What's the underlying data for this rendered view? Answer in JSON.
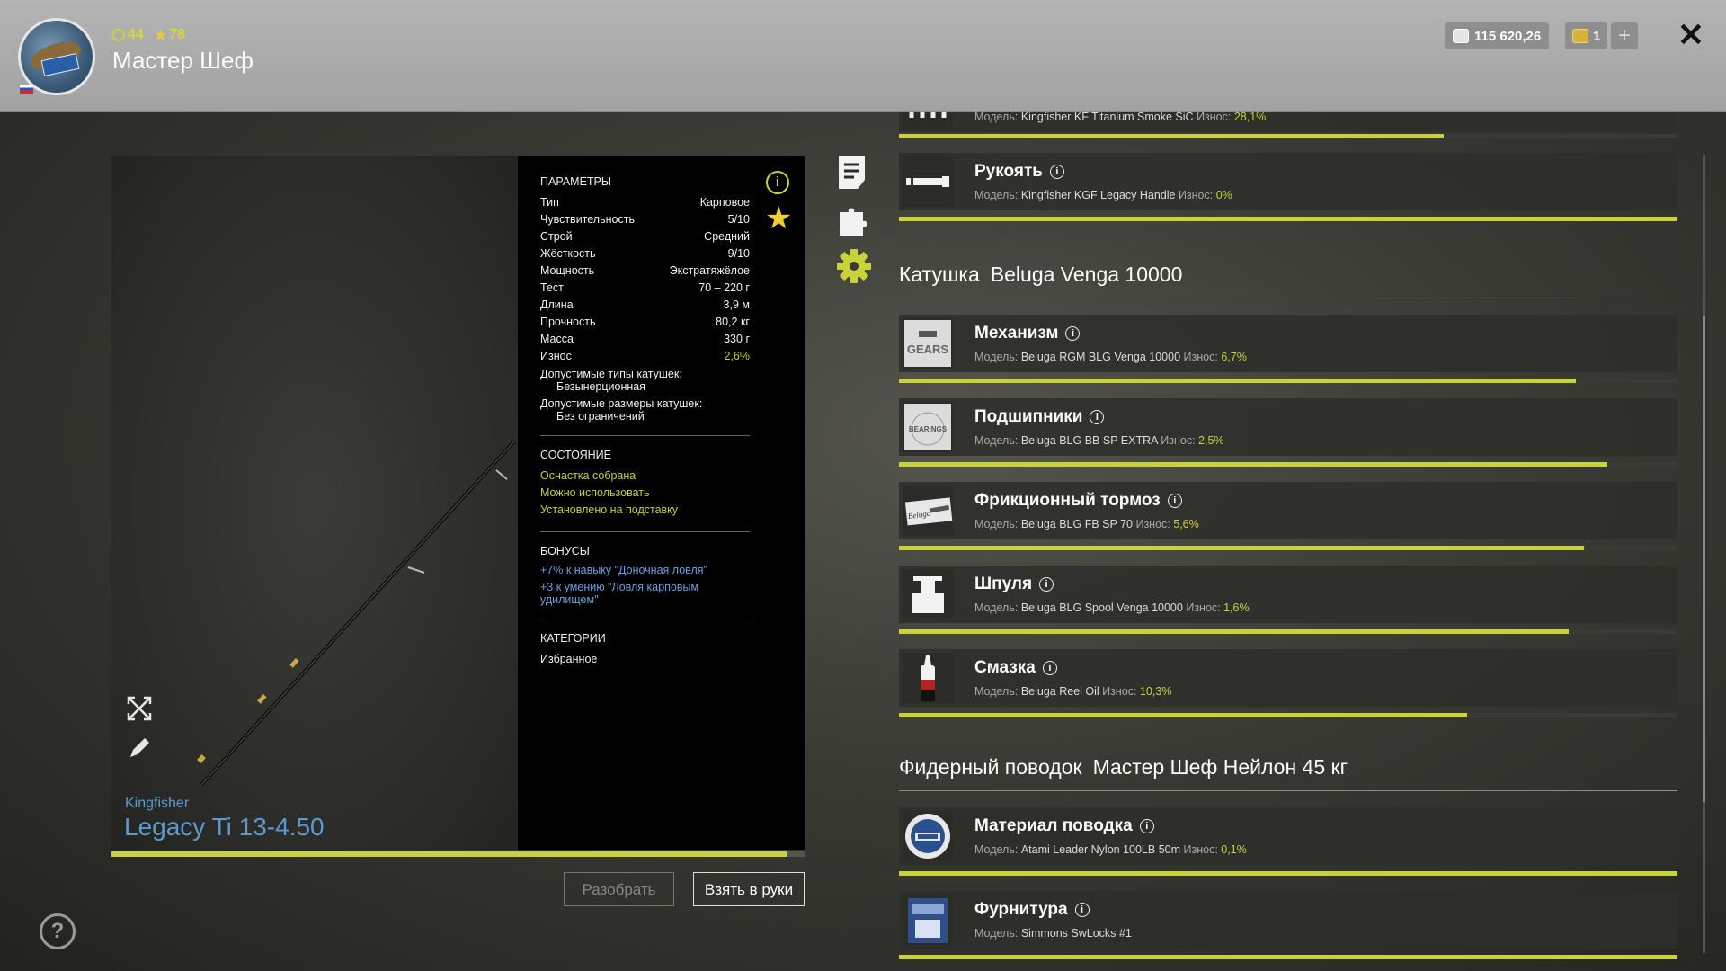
{
  "header": {
    "level": "44",
    "stars": "78",
    "player_name": "Мастер Шеф",
    "silver": "115 620,26",
    "gold": "1",
    "plus_label": "+",
    "close_label": "✕"
  },
  "rod": {
    "brand": "Kingfisher",
    "name": "Legacy Ti 13-4.50",
    "condition_percent": 97.4
  },
  "params": {
    "title": "ПАРАМЕТРЫ",
    "rows": [
      {
        "label": "Тип",
        "value": "Карповое"
      },
      {
        "label": "Чувствительность",
        "value": "5/10"
      },
      {
        "label": "Строй",
        "value": "Средний"
      },
      {
        "label": "Жёсткость",
        "value": "9/10"
      },
      {
        "label": "Мощность",
        "value": "Экстратяжёлое"
      },
      {
        "label": "Тест",
        "value": "70 – 220 г"
      },
      {
        "label": "Длина",
        "value": "3,9 м"
      },
      {
        "label": "Прочность",
        "value": "80,2 кг"
      },
      {
        "label": "Масса",
        "value": "330 г"
      },
      {
        "label": "Износ",
        "value": "2,6%"
      }
    ],
    "reel_types_label": "Допустимые типы катушек:",
    "reel_types_value": "Безынерционная",
    "reel_sizes_label": "Допустимые размеры катушек:",
    "reel_sizes_value": "Без ограничений",
    "state_title": "СОСТОЯНИЕ",
    "state_lines": [
      "Оснастка собрана",
      "Можно использовать",
      "Установлено на подставку"
    ],
    "bonus_title": "БОНУСЫ",
    "bonus_1": "+7% к навыку \"Доночная ловля\"",
    "bonus_2": "+3 к умению \"Ловля карповым удилищем\"",
    "categories_title": "КАТЕГОРИИ",
    "categories_value": "Избранное"
  },
  "buttons": {
    "disassemble": "Разобрать",
    "take": "Взять в руки"
  },
  "labels": {
    "model": "Модель:",
    "wear": "Износ:"
  },
  "top_partial": {
    "model": "Kingfisher KF Titanium Smoke SiC",
    "wear": "28,1%",
    "wear_fraction": 0.7
  },
  "handle": {
    "name": "Рукоять",
    "model": "Kingfisher KGF Legacy Handle",
    "wear": "0%",
    "wear_fraction": 1.0
  },
  "reel": {
    "section_label": "Катушка",
    "section_name": "Beluga Venga 10000",
    "components": [
      {
        "name": "Механизм",
        "model": "Beluga RGM BLG Venga 10000",
        "wear": "6,7%",
        "icon": "gears-box-icon",
        "icon_text": "GEARS",
        "fill": 0.87
      },
      {
        "name": "Подшипники",
        "model": "Beluga BLG BB SP EXTRA",
        "wear": "2,5%",
        "icon": "bearings-box-icon",
        "icon_text": "BEARINGS",
        "fill": 0.91
      },
      {
        "name": "Фрикционный тормоз",
        "model": "Beluga BLG FB SP 70",
        "wear": "5,6%",
        "icon": "friction-brake-icon",
        "icon_text": "Beluga",
        "fill": 0.88
      },
      {
        "name": "Шпуля",
        "model": "Beluga BLG Spool Venga 10000",
        "wear": "1,6%",
        "icon": "spool-icon",
        "icon_text": "",
        "fill": 0.86
      },
      {
        "name": "Смазка",
        "model": "Beluga Reel Oil",
        "wear": "10,3%",
        "icon": "oil-bottle-icon",
        "icon_text": "",
        "fill": 0.73
      }
    ]
  },
  "leader": {
    "section_label": "Фидерный поводок",
    "section_name": "Мастер Шеф Нейлон 45 кг",
    "components": [
      {
        "name": "Материал поводка",
        "model": "Atami Leader Nylon 100LB 50m",
        "wear": "0,1%",
        "icon": "leader-spool-icon",
        "fill": 1.0
      },
      {
        "name": "Фурнитура",
        "model": "Simmons SwLocks #1",
        "wear": "",
        "icon": "tackle-pack-icon",
        "fill": 1.0
      }
    ]
  },
  "colors": {
    "accent": "#c8d23a",
    "link_blue": "#5b9ad0",
    "panel_black": "#000000"
  }
}
